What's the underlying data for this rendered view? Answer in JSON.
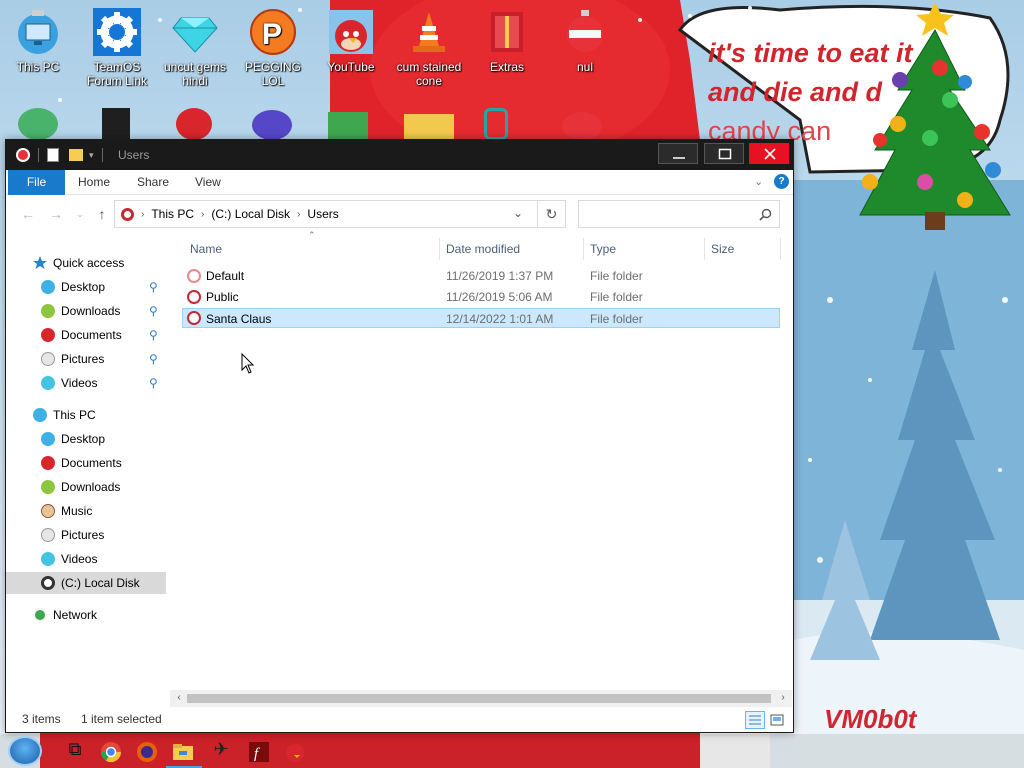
{
  "desktop": {
    "icons": [
      {
        "label": "This PC",
        "icon": "monitor-icon"
      },
      {
        "label": "TeamOS Forum Link",
        "icon": "gear-icon"
      },
      {
        "label": "uncut gems hindi",
        "icon": "diamond-icon"
      },
      {
        "label": "PEGGING LOL",
        "icon": "p-logo-icon"
      },
      {
        "label": "YouTube",
        "icon": "angry-bird-icon"
      },
      {
        "label": "cum stained cone",
        "icon": "traffic-cone-icon"
      },
      {
        "label": "Extras",
        "icon": "red-box-icon"
      },
      {
        "label": "nul",
        "icon": "ornament-icon"
      }
    ],
    "wallpaper_text": [
      "it's time to eat it",
      "and die and d",
      "candy can"
    ],
    "signature": "VM0b0t"
  },
  "window": {
    "title": "Users",
    "ribbon_tabs": [
      "File",
      "Home",
      "Share",
      "View"
    ],
    "breadcrumb": [
      "This PC",
      "(C:) Local Disk",
      "Users"
    ],
    "search_placeholder": "",
    "nav": {
      "quick_access": "Quick access",
      "quick_items": [
        "Desktop",
        "Downloads",
        "Documents",
        "Pictures",
        "Videos"
      ],
      "this_pc": "This PC",
      "pc_items": [
        "Desktop",
        "Documents",
        "Downloads",
        "Music",
        "Pictures",
        "Videos",
        "(C:) Local Disk"
      ],
      "network": "Network"
    },
    "columns": [
      "Name",
      "Date modified",
      "Type",
      "Size"
    ],
    "rows": [
      {
        "name": "Default",
        "date": "11/26/2019 1:37 PM",
        "type": "File folder",
        "size": ""
      },
      {
        "name": "Public",
        "date": "11/26/2019 5:06 AM",
        "type": "File folder",
        "size": ""
      },
      {
        "name": "Santa Claus",
        "date": "12/14/2022 1:01 AM",
        "type": "File folder",
        "size": ""
      }
    ],
    "status": {
      "items": "3 items",
      "selected": "1 item selected"
    }
  },
  "colors": {
    "accent": "#1979ca",
    "close": "#e81123",
    "selection": "#cce8ff",
    "wallpaper_red": "#d0252c"
  }
}
